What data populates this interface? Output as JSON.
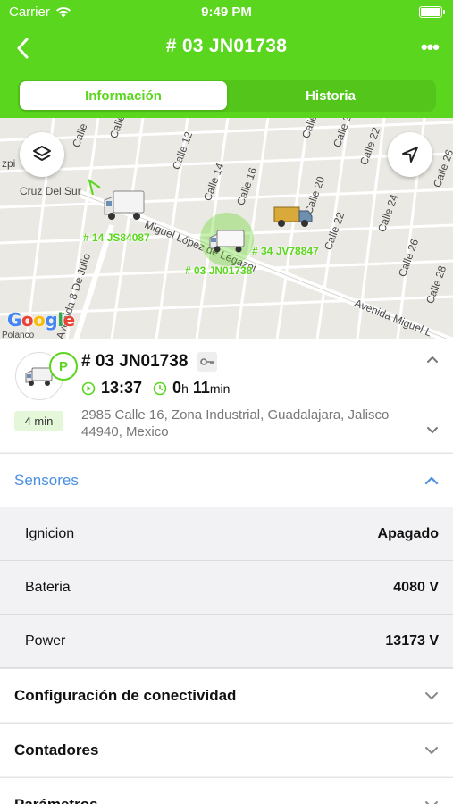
{
  "status": {
    "carrier": "Carrier",
    "time": "9:49 PM"
  },
  "nav": {
    "title": "# 03 JN01738",
    "more": "•••"
  },
  "tabs": [
    {
      "label": "Información",
      "active": true
    },
    {
      "label": "Historia",
      "active": false
    }
  ],
  "map": {
    "streets": [
      "Calle",
      "Calle",
      "Calle 12",
      "Calle 14",
      "Calle 16",
      "Calle 20",
      "Calle",
      "Calle 2",
      "Calle 22",
      "Calle 22",
      "Calle 24",
      "Calle 26",
      "Calle 28",
      "Calle 26",
      "Miguel López de Legazpi",
      "Avenida Miguel L",
      "Avenida 8 De Julio",
      "Cruz Del Sur",
      "zpi",
      "Polanco"
    ],
    "vehicles": [
      "# 14 JS84087",
      "# 34 JV78847",
      "# 03 JN01738"
    ],
    "google": "Google"
  },
  "vehicle": {
    "title": "# 03 JN01738",
    "parking_badge": "P",
    "time": "13:37",
    "duration_hours": "0",
    "duration_h_unit": "h",
    "duration_minutes": "11",
    "duration_min_unit": "min",
    "since_badge": "4 min",
    "address": "2985 Calle 16, Zona Industrial, Guadalajara, Jalisco 44940, Mexico"
  },
  "sensors": {
    "label": "Sensores",
    "rows": [
      {
        "name": "Ignicion",
        "value": "Apagado"
      },
      {
        "name": "Bateria",
        "value": "4080 V"
      },
      {
        "name": "Power",
        "value": "13173 V"
      }
    ]
  },
  "sections": [
    {
      "label": "Configuración de conectividad"
    },
    {
      "label": "Contadores"
    },
    {
      "label": "Parámetros"
    }
  ],
  "colors": {
    "accent": "#5bd61e",
    "link": "#4a8fe0"
  }
}
